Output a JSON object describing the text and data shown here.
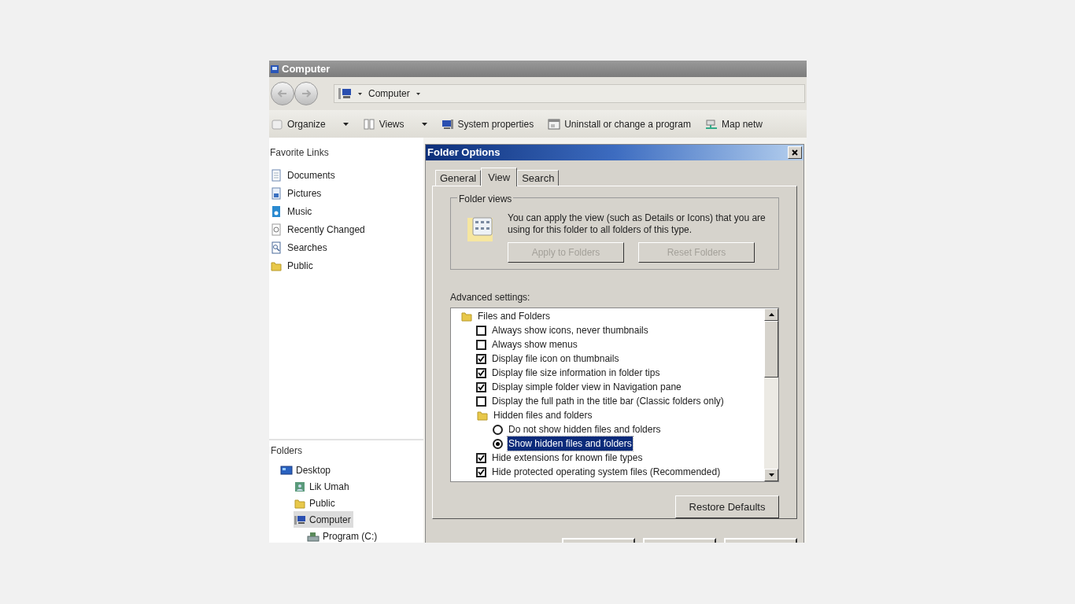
{
  "explorer": {
    "title": "Computer",
    "address": "Computer",
    "toolbar": [
      {
        "label": "Organize",
        "dropdown": true,
        "kind": "organize"
      },
      {
        "label": "Views",
        "dropdown": true,
        "kind": "views"
      },
      {
        "label": "System properties",
        "dropdown": false,
        "kind": "system"
      },
      {
        "label": "Uninstall or change a program",
        "dropdown": false,
        "kind": "uninstall"
      },
      {
        "label": "Map netw",
        "dropdown": false,
        "kind": "network"
      }
    ],
    "favorites": {
      "heading": "Favorite Links",
      "items": [
        {
          "label": "Documents",
          "kind": "documents",
          "selected": false
        },
        {
          "label": "Pictures",
          "kind": "pictures",
          "selected": false
        },
        {
          "label": "Music",
          "kind": "music",
          "selected": false
        },
        {
          "label": "Recently Changed",
          "kind": "recent",
          "selected": false
        },
        {
          "label": "Searches",
          "kind": "searches",
          "selected": false
        },
        {
          "label": "Public",
          "kind": "folder",
          "selected": false
        }
      ]
    },
    "folders": {
      "heading": "Folders",
      "tree": [
        {
          "label": "Desktop",
          "kind": "desktop",
          "selected": false,
          "children": [
            {
              "label": "Lik Umah",
              "kind": "user",
              "selected": false
            },
            {
              "label": "Public",
              "kind": "folder",
              "selected": false
            },
            {
              "label": "Computer",
              "kind": "computer",
              "selected": true,
              "children": [
                {
                  "label": "Program (C:)",
                  "kind": "drive",
                  "selected": false
                }
              ]
            }
          ]
        }
      ]
    }
  },
  "dialog": {
    "title": "Folder Options",
    "tabs": [
      {
        "label": "General",
        "selected": false
      },
      {
        "label": "View",
        "selected": true
      },
      {
        "label": "Search",
        "selected": false
      }
    ],
    "folder_views": {
      "legend": "Folder views",
      "text": "You can apply the view (such as Details or Icons) that you are using for this folder to all folders of this type.",
      "buttons": [
        {
          "label": "Apply to Folders",
          "disabled": true
        },
        {
          "label": "Reset Folders",
          "disabled": true
        }
      ]
    },
    "advanced_label": "Advanced settings:",
    "advanced": [
      {
        "kind": "group",
        "label": "Files and Folders",
        "children": [
          {
            "kind": "checkbox",
            "label": "Always show icons, never thumbnails",
            "checked": false,
            "selected": false
          },
          {
            "kind": "checkbox",
            "label": "Always show menus",
            "checked": false,
            "selected": false
          },
          {
            "kind": "checkbox",
            "label": "Display file icon on thumbnails",
            "checked": true,
            "selected": false
          },
          {
            "kind": "checkbox",
            "label": "Display file size information in folder tips",
            "checked": true,
            "selected": false
          },
          {
            "kind": "checkbox",
            "label": "Display simple folder view in Navigation pane",
            "checked": true,
            "selected": false
          },
          {
            "kind": "checkbox",
            "label": "Display the full path in the title bar (Classic folders only)",
            "checked": false,
            "selected": false
          },
          {
            "kind": "group",
            "label": "Hidden files and folders",
            "children": [
              {
                "kind": "radio",
                "label": "Do not show hidden files and folders",
                "checked": false,
                "selected": false
              },
              {
                "kind": "radio",
                "label": "Show hidden files and folders",
                "checked": true,
                "selected": true
              }
            ]
          },
          {
            "kind": "checkbox",
            "label": "Hide extensions for known file types",
            "checked": true,
            "selected": false
          },
          {
            "kind": "checkbox",
            "label": "Hide protected operating system files (Recommended)",
            "checked": true,
            "selected": false
          }
        ]
      }
    ],
    "restore_button": "Restore Defaults"
  }
}
